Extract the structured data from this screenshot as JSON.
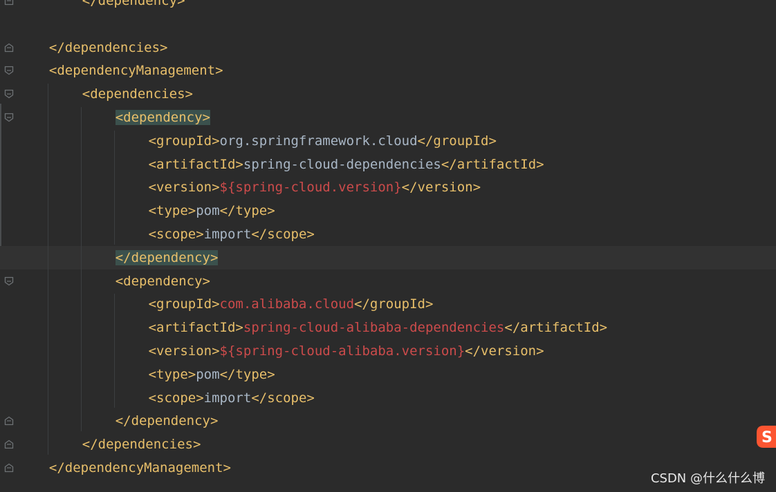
{
  "editor": {
    "lines": [
      {
        "indent": 2,
        "tokens": [
          {
            "t": "tag",
            "v": "</dependency>"
          }
        ]
      },
      {
        "indent": 0,
        "tokens": []
      },
      {
        "indent": 1,
        "tokens": [
          {
            "t": "tag",
            "v": "</dependencies>"
          }
        ]
      },
      {
        "indent": 1,
        "tokens": [
          {
            "t": "tag",
            "v": "<dependencyManagement>"
          }
        ]
      },
      {
        "indent": 2,
        "tokens": [
          {
            "t": "tag",
            "v": "<dependencies>"
          }
        ]
      },
      {
        "indent": 3,
        "tokens": [
          {
            "t": "hl-open",
            "v": "<dependency>"
          }
        ]
      },
      {
        "indent": 4,
        "tokens": [
          {
            "t": "tag",
            "v": "<groupId>"
          },
          {
            "t": "text",
            "v": "org.springframework.cloud"
          },
          {
            "t": "tag",
            "v": "</groupId>"
          }
        ]
      },
      {
        "indent": 4,
        "tokens": [
          {
            "t": "tag",
            "v": "<artifactId>"
          },
          {
            "t": "text",
            "v": "spring-cloud-dependencies"
          },
          {
            "t": "tag",
            "v": "</artifactId>"
          }
        ]
      },
      {
        "indent": 4,
        "tokens": [
          {
            "t": "tag",
            "v": "<version>"
          },
          {
            "t": "prop",
            "v": "${spring-cloud.version}"
          },
          {
            "t": "tag",
            "v": "</version>"
          }
        ]
      },
      {
        "indent": 4,
        "tokens": [
          {
            "t": "tag",
            "v": "<type>"
          },
          {
            "t": "text",
            "v": "pom"
          },
          {
            "t": "tag",
            "v": "</type>"
          }
        ]
      },
      {
        "indent": 4,
        "tokens": [
          {
            "t": "tag",
            "v": "<scope>"
          },
          {
            "t": "text",
            "v": "import"
          },
          {
            "t": "tag",
            "v": "</scope>"
          }
        ]
      },
      {
        "indent": 3,
        "current": true,
        "tokens": [
          {
            "t": "hl-close",
            "v": "</dependency>"
          }
        ]
      },
      {
        "indent": 3,
        "tokens": [
          {
            "t": "tag",
            "v": "<dependency>"
          }
        ]
      },
      {
        "indent": 4,
        "tokens": [
          {
            "t": "tag",
            "v": "<groupId>"
          },
          {
            "t": "prop",
            "v": "com.alibaba.cloud"
          },
          {
            "t": "tag",
            "v": "</groupId>"
          }
        ]
      },
      {
        "indent": 4,
        "tokens": [
          {
            "t": "tag",
            "v": "<artifactId>"
          },
          {
            "t": "prop",
            "v": "spring-cloud-alibaba-dependencies"
          },
          {
            "t": "tag",
            "v": "</artifactId>"
          }
        ]
      },
      {
        "indent": 4,
        "tokens": [
          {
            "t": "tag",
            "v": "<version>"
          },
          {
            "t": "prop",
            "v": "${spring-cloud-alibaba.version}"
          },
          {
            "t": "tag",
            "v": "</version>"
          }
        ]
      },
      {
        "indent": 4,
        "tokens": [
          {
            "t": "tag",
            "v": "<type>"
          },
          {
            "t": "text",
            "v": "pom"
          },
          {
            "t": "tag",
            "v": "</type>"
          }
        ]
      },
      {
        "indent": 4,
        "tokens": [
          {
            "t": "tag",
            "v": "<scope>"
          },
          {
            "t": "text",
            "v": "import"
          },
          {
            "t": "tag",
            "v": "</scope>"
          }
        ]
      },
      {
        "indent": 3,
        "tokens": [
          {
            "t": "tag",
            "v": "</dependency>"
          }
        ]
      },
      {
        "indent": 2,
        "tokens": [
          {
            "t": "tag",
            "v": "</dependencies>"
          }
        ]
      },
      {
        "indent": 1,
        "tokens": [
          {
            "t": "tag",
            "v": "</dependencyManagement>"
          }
        ]
      }
    ],
    "fold_markers": [
      {
        "line": 0,
        "kind": "end"
      },
      {
        "line": 2,
        "kind": "end"
      },
      {
        "line": 3,
        "kind": "start"
      },
      {
        "line": 4,
        "kind": "start"
      },
      {
        "line": 5,
        "kind": "start"
      },
      {
        "line": 11,
        "kind": "end"
      },
      {
        "line": 12,
        "kind": "start"
      },
      {
        "line": 18,
        "kind": "end"
      },
      {
        "line": 19,
        "kind": "end"
      },
      {
        "line": 20,
        "kind": "end"
      }
    ]
  },
  "watermark": {
    "text": "CSDN @什么什么博",
    "logo_icon": "csdn-logo-icon"
  },
  "colors": {
    "background": "#2b2b2b",
    "tag": "#e8bf6a",
    "text": "#a9b7c6",
    "property": "#cc4b4b",
    "current_line": "#323232",
    "match_highlight": "#3b514d"
  }
}
